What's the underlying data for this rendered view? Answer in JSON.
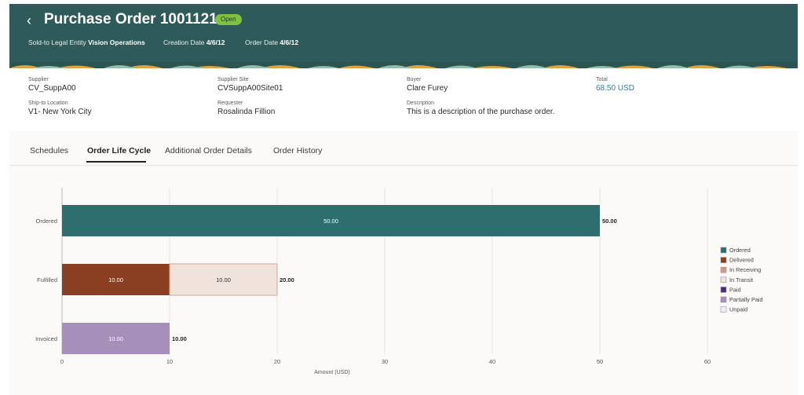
{
  "header": {
    "back_icon": "chevron-left-icon",
    "title": "Purchase Order 1001121",
    "status": "Open",
    "legal_entity_label": "Sold-to Legal Entity",
    "legal_entity_value": "Vision Operations",
    "creation_date_label": "Creation Date",
    "creation_date_value": "4/6/12",
    "order_date_label": "Order Date",
    "order_date_value": "4/6/12"
  },
  "info": {
    "supplier_label": "Supplier",
    "supplier_value": "CV_SuppA00",
    "supplier_site_label": "Supplier Site",
    "supplier_site_value": "CVSuppA00Site01",
    "buyer_label": "Buyer",
    "buyer_value": "Clare Furey",
    "total_label": "Total",
    "total_value": "68.50 USD",
    "ship_to_label": "Ship-to Location",
    "ship_to_value": "V1- New York City",
    "requester_label": "Requester",
    "requester_value": "Rosalinda Fillion",
    "description_label": "Description",
    "description_value": "This is a description of the purchase order."
  },
  "tabs": [
    {
      "label": "Schedules",
      "active": false
    },
    {
      "label": "Order Life Cycle",
      "active": true
    },
    {
      "label": "Additional Order Details",
      "active": false
    },
    {
      "label": "Order History",
      "active": false
    }
  ],
  "colors": {
    "header_bg": "#2f5a5a",
    "status_badge": "#7fc143",
    "ordered": "#2e6e6e",
    "delivered": "#8a3f22",
    "in_receiving": "#d59a85",
    "in_transit": "#efe3db",
    "paid": "#4b2e7a",
    "partially_paid": "#a68fb8",
    "unpaid": "#f2eef7"
  },
  "chart_data": {
    "type": "bar",
    "orientation": "horizontal",
    "stacked": true,
    "xlabel": "Amount (USD)",
    "xlim": [
      0,
      60
    ],
    "xticks": [
      0,
      10,
      20,
      30,
      40,
      50,
      60
    ],
    "grid": true,
    "legend_position": "right",
    "categories": [
      "Ordered",
      "Fulfilled",
      "Invoiced"
    ],
    "series": [
      {
        "name": "Ordered",
        "color": "#2e6e6e",
        "values": [
          50,
          0,
          0
        ]
      },
      {
        "name": "Delivered",
        "color": "#8a3f22",
        "values": [
          0,
          10,
          0
        ]
      },
      {
        "name": "In Receiving",
        "color": "#d59a85",
        "values": [
          0,
          0,
          0
        ]
      },
      {
        "name": "In Transit",
        "color": "#efe3db",
        "values": [
          0,
          10,
          0
        ]
      },
      {
        "name": "Paid",
        "color": "#4b2e7a",
        "values": [
          0,
          0,
          0
        ]
      },
      {
        "name": "Partially Paid",
        "color": "#a68fb8",
        "values": [
          0,
          0,
          10
        ]
      },
      {
        "name": "Unpaid",
        "color": "#f2eef7",
        "values": [
          0,
          0,
          0
        ]
      }
    ],
    "segment_labels": [
      "50.00",
      "10.00",
      "10.00",
      "10.00"
    ],
    "totals": [
      "50.00",
      "20.00",
      "10.00"
    ]
  }
}
